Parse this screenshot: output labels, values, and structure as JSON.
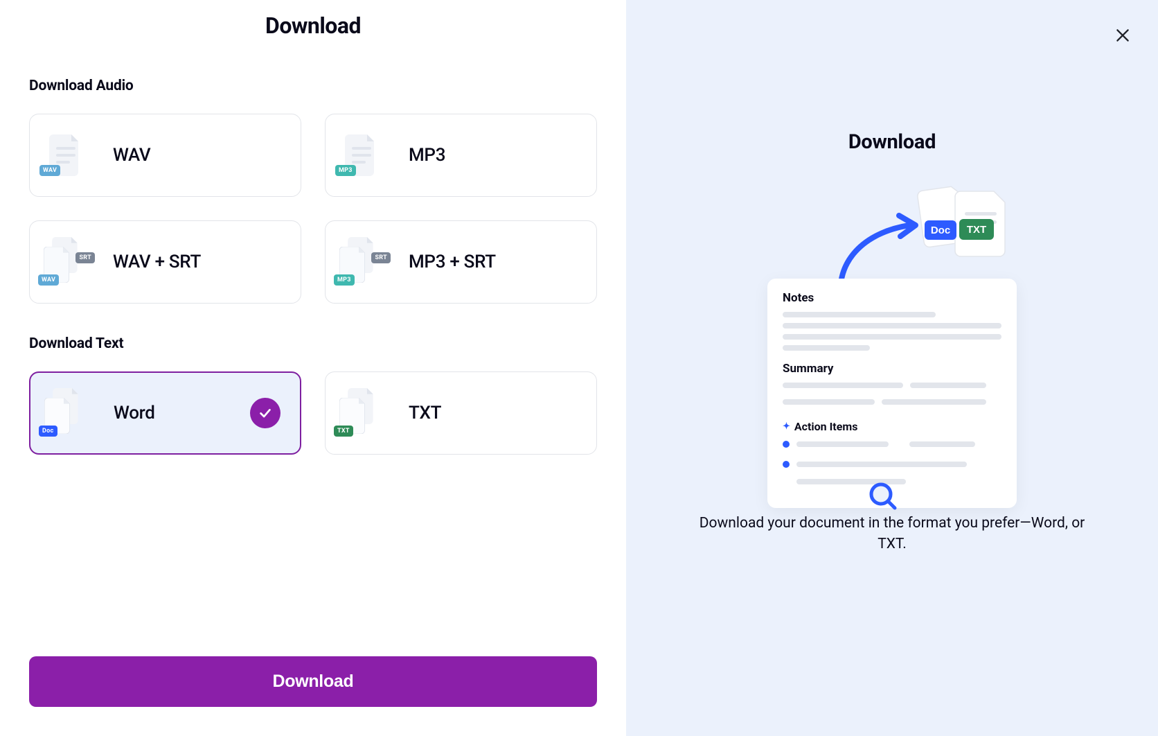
{
  "title": "Download",
  "audio": {
    "heading": "Download Audio",
    "options": [
      {
        "label": "WAV",
        "badge": "WAV",
        "badge_color": "#5FA9D6",
        "dual": false
      },
      {
        "label": "MP3",
        "badge": "MP3",
        "badge_color": "#3FB8AF",
        "dual": false
      },
      {
        "label": "WAV + SRT",
        "badge": "WAV",
        "badge_color": "#5FA9D6",
        "dual": true,
        "badge2": "SRT",
        "badge2_color": "#7A8494"
      },
      {
        "label": "MP3 + SRT",
        "badge": "MP3",
        "badge_color": "#3FB8AF",
        "dual": true,
        "badge2": "SRT",
        "badge2_color": "#7A8494"
      }
    ]
  },
  "text": {
    "heading": "Download Text",
    "options": [
      {
        "label": "Word",
        "badge": "Doc",
        "badge_color": "#2D5BFF",
        "selected": true
      },
      {
        "label": "TXT",
        "badge": "TXT",
        "badge_color": "#2E8B57",
        "selected": false
      }
    ]
  },
  "button_label": "Download",
  "right": {
    "title": "Download",
    "description": "Download your document in the format you prefer—Word, or TXT.",
    "notes_label": "Notes",
    "summary_label": "Summary",
    "action_items_label": "Action Items",
    "doc_badge": "Doc",
    "txt_badge": "TXT"
  }
}
